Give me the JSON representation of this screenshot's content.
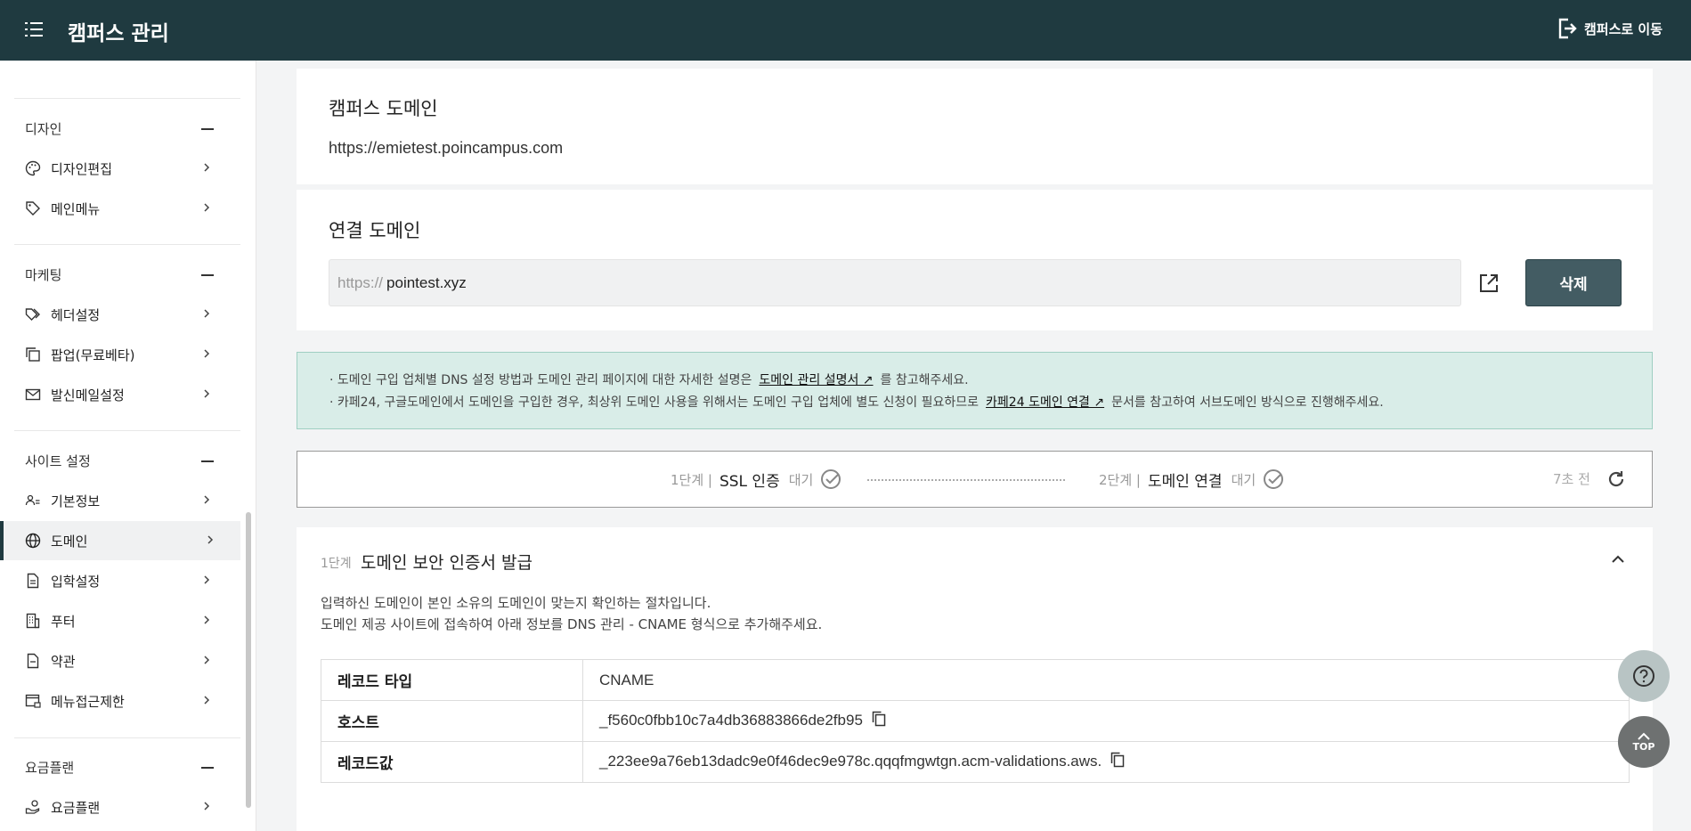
{
  "header": {
    "title": "캠퍼스 관리",
    "goto_label": "캠퍼스로 이동"
  },
  "sidebar": {
    "sections": [
      {
        "label": "디자인",
        "items": [
          {
            "label": "디자인편집",
            "icon": "palette-icon"
          },
          {
            "label": "메인메뉴",
            "icon": "tag-icon"
          }
        ]
      },
      {
        "label": "마케팅",
        "items": [
          {
            "label": "헤더설정",
            "icon": "tags-icon"
          },
          {
            "label": "팝업(무료베타)",
            "icon": "copy-windows-icon"
          },
          {
            "label": "발신메일설정",
            "icon": "mail-icon"
          }
        ]
      },
      {
        "label": "사이트 설정",
        "items": [
          {
            "label": "기본정보",
            "icon": "users-icon"
          },
          {
            "label": "도메인",
            "icon": "globe-icon"
          },
          {
            "label": "입학설정",
            "icon": "document-icon"
          },
          {
            "label": "푸터",
            "icon": "building-icon"
          },
          {
            "label": "약관",
            "icon": "file-icon"
          },
          {
            "label": "메뉴접근제한",
            "icon": "window-lock-icon"
          }
        ]
      },
      {
        "label": "요금플랜",
        "items": [
          {
            "label": "요금플랜",
            "icon": "hand-coin-icon"
          }
        ]
      }
    ],
    "active_item": "도메인"
  },
  "campus_domain": {
    "title": "캠퍼스 도메인",
    "url": "https://emietest.poincampus.com"
  },
  "linked_domain": {
    "title": "연결 도메인",
    "prefix": "https://",
    "value": "pointest.xyz",
    "delete_label": "삭제"
  },
  "notice": {
    "line1_pre": "· 도메인 구입 업체별 DNS 설정 방법과 도메인 관리 페이지에 대한 자세한 설명은",
    "line1_link": "도메인 관리 설명서 ↗",
    "line1_post": "를 참고해주세요.",
    "line2_pre": "· 카페24, 구글도메인에서 도메인을 구입한 경우, 최상위 도메인 사용을 위해서는 도메인 구입 업체에 별도 신청이 필요하므로",
    "line2_link": "카페24 도메인 연결 ↗",
    "line2_post": "문서를 참고하여 서브도메인 방식으로 진행해주세요."
  },
  "steps": {
    "step1": {
      "num": "1단계 |",
      "name": "SSL 인증",
      "state": "대기"
    },
    "step2": {
      "num": "2단계 |",
      "name": "도메인 연결",
      "state": "대기"
    },
    "elapsed": "7초 전"
  },
  "detail": {
    "num": "1단계",
    "title": "도메인 보안 인증서 발급",
    "desc1": "입력하신 도메인이 본인 소유의 도메인이 맞는지 확인하는 절차입니다.",
    "desc2": "도메인 제공 사이트에 접속하여 아래 정보를 DNS 관리 - CNAME 형식으로 추가해주세요.",
    "records": [
      {
        "key": "레코드 타입",
        "value": "CNAME"
      },
      {
        "key": "호스트",
        "value": "_f560c0fbb10c7a4db36883866de2fb95"
      },
      {
        "key": "레코드값",
        "value": "_223ee9a76eb13dadc9e0f46dec9e978c.qqqfmgwtgn.acm-validations.aws."
      }
    ]
  },
  "floating": {
    "top_label": "TOP"
  },
  "colors": {
    "header_bg": "#1f3a40",
    "delete_button_bg": "#435c63",
    "notice_bg": "#d9ede8"
  }
}
